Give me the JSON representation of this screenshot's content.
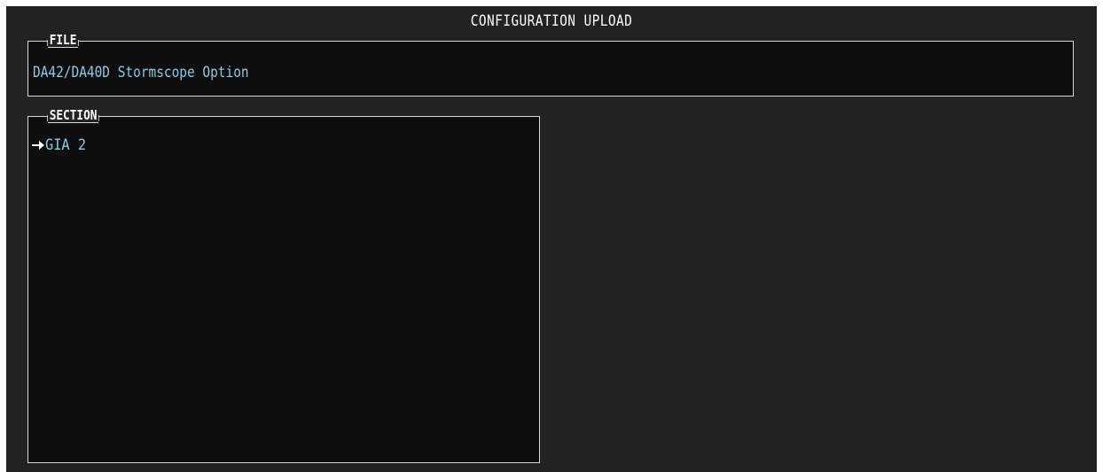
{
  "page": {
    "title": "CONFIGURATION UPLOAD"
  },
  "file": {
    "label": "FILE",
    "value": "DA42/DA40D Stormscope Option"
  },
  "section": {
    "label": "SECTION",
    "items": [
      {
        "label": "GIA 2",
        "selected": true,
        "icon": "right-arrow-icon"
      }
    ]
  },
  "colors": {
    "background": "#232222",
    "panel": "#0e0e0e",
    "border": "#d8d8d8",
    "value_text": "#8fc8e8",
    "title_text": "#ffffff"
  }
}
